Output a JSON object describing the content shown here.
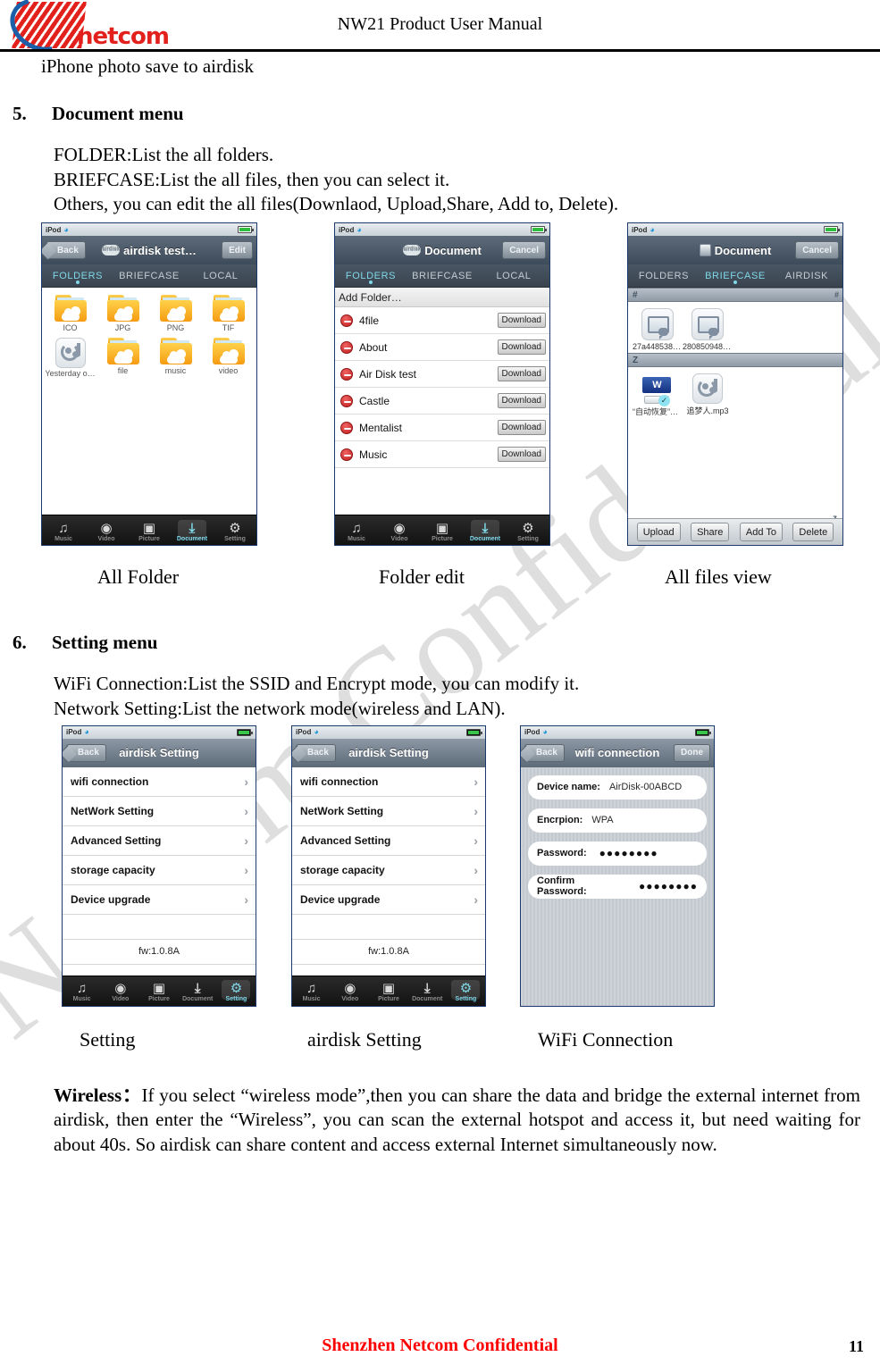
{
  "header": {
    "logo_word": "netcom",
    "title": "NW21 Product User Manual"
  },
  "lead_line": "iPhone photo save to airdisk",
  "sections": [
    {
      "number": "5.",
      "title": "Document menu",
      "lines": [
        "FOLDER:List the all folders.",
        "BRIEFCASE:List the all files, then you can select it.",
        "Others, you can edit the all files(Downlaod, Upload,Share, Add to, Delete)."
      ]
    },
    {
      "number": "6.",
      "title": "Setting menu",
      "lines": [
        "WiFi Connection:List the SSID and Encrypt mode, you can modify it.",
        "Network Setting:List the network mode(wireless and LAN)."
      ]
    }
  ],
  "captions_row1": [
    "All Folder",
    "Folder edit",
    "All files view"
  ],
  "captions_row2": [
    "Setting",
    "airdisk Setting",
    "WiFi Connection"
  ],
  "wireless": {
    "label": "Wireless：",
    "text": "If you select “wireless mode”,then you can share the data and bridge the external internet from airdisk, then enter the “Wireless”, you can scan the external hotspot and access it, but need waiting for about 40s. So airdisk can share content and access external Internet simultaneously now."
  },
  "watermark": "Netcom Confidential",
  "footer": {
    "text": "Shenzhen Netcom Confidential",
    "page": "11"
  },
  "phones": {
    "all_folder": {
      "status_carrier": "iPod",
      "back_label": "Back",
      "nav_title": "airdisk test…",
      "badge_label": "airdisk",
      "right_button": "Edit",
      "tabs": [
        "FOLDERS",
        "BRIEFCASE",
        "LOCAL"
      ],
      "active_tab": "FOLDERS",
      "items": [
        {
          "label": "ICO",
          "icon": "folder-icon"
        },
        {
          "label": "JPG",
          "icon": "folder-icon"
        },
        {
          "label": "PNG",
          "icon": "folder-icon"
        },
        {
          "label": "TIF",
          "icon": "folder-icon"
        },
        {
          "label": "Yesterday o…",
          "icon": "music-file-icon"
        },
        {
          "label": "file",
          "icon": "folder-icon"
        },
        {
          "label": "music",
          "icon": "folder-icon"
        },
        {
          "label": "video",
          "icon": "folder-icon"
        }
      ],
      "tabbar": [
        "Music",
        "Video",
        "Picture",
        "Document",
        "Setting"
      ],
      "tabbar_active": "Document"
    },
    "folder_edit": {
      "status_carrier": "iPod",
      "nav_title": "Document",
      "badge_label": "airdisk",
      "right_button": "Cancel",
      "tabs": [
        "FOLDERS",
        "BRIEFCASE",
        "LOCAL"
      ],
      "active_tab": "FOLDERS",
      "add_folder": "Add Folder…",
      "download_label": "Download",
      "rows": [
        "4file",
        "About",
        "Air Disk test",
        "Castle",
        "Mentalist",
        "Music"
      ],
      "tabbar": [
        "Music",
        "Video",
        "Picture",
        "Document",
        "Setting"
      ],
      "tabbar_active": "Document"
    },
    "all_files": {
      "status_carrier": "iPod",
      "nav_title": "Document",
      "right_button": "Cancel",
      "tabs": [
        "FOLDERS",
        "BRIEFCASE",
        "AIRDISK"
      ],
      "active_tab": "BRIEFCASE",
      "groups": [
        {
          "header": "#",
          "index": "#",
          "files": [
            {
              "label": "27a448538ff…",
              "icon": "picture-file-icon",
              "checked": false
            },
            {
              "label": "2808509481…",
              "icon": "picture-file-icon",
              "checked": false
            }
          ]
        },
        {
          "header": "Z",
          "index": "z",
          "files": [
            {
              "label": "“自动恢复”保…",
              "icon": "word-file-icon",
              "checked": true
            },
            {
              "label": "追梦人.mp3",
              "icon": "music-file-icon",
              "checked": false
            }
          ]
        }
      ],
      "actions": [
        "Upload",
        "Share",
        "Add To",
        "Delete"
      ]
    },
    "setting": {
      "status_carrier": "iPod",
      "back_label": "Back",
      "nav_title": "airdisk Setting",
      "rows": [
        "wifi connection",
        "NetWork Setting",
        "Advanced Setting",
        "storage capacity",
        "Device upgrade"
      ],
      "firmware": "fw:1.0.8A",
      "tabbar": [
        "Music",
        "Video",
        "Picture",
        "Document",
        "Setting"
      ],
      "tabbar_active": "Setting"
    },
    "wifi": {
      "status_carrier": "iPod",
      "back_label": "Back",
      "nav_title": "wifi connection",
      "right_button": "Done",
      "fields": [
        {
          "key": "Device name:",
          "value": "AirDisk-00ABCD",
          "type": "text"
        },
        {
          "key": "Encrpion:",
          "value": "WPA",
          "type": "text"
        },
        {
          "key": "Password:",
          "value": "●●●●●●●●",
          "type": "password"
        },
        {
          "key": "Confirm Password:",
          "value": "●●●●●●●●",
          "type": "password"
        }
      ]
    }
  },
  "colors": {
    "brand_red": "#e2211c",
    "brand_blue": "#1b5fa8",
    "accent_cyan": "#7fd8e8",
    "footer_red": "#ff0000"
  }
}
